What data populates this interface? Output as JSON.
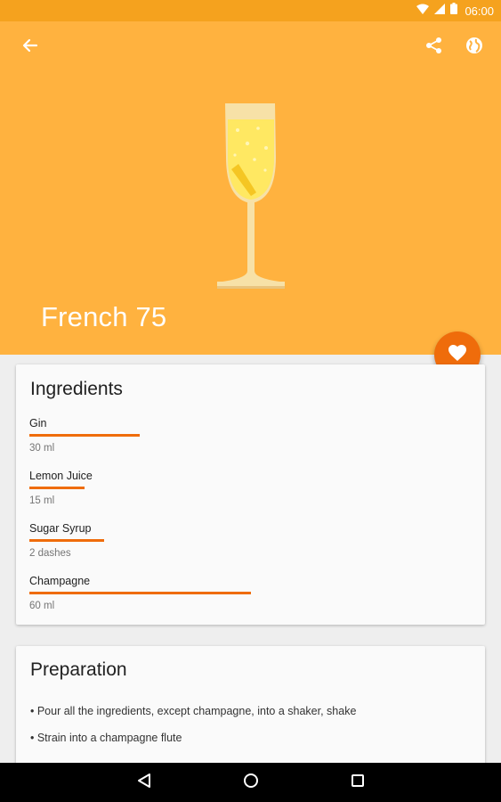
{
  "status_bar": {
    "time": "06:00"
  },
  "header": {
    "title": "French 75",
    "color": "#FFB23F",
    "actions": [
      "back-arrow-icon",
      "share-icon",
      "globe-icon"
    ]
  },
  "fab": {
    "icon": "heart-icon",
    "color": "#EF6C0B"
  },
  "ingredients": {
    "heading": "Ingredients",
    "items": [
      {
        "name": "Gin",
        "amount": "30 ml",
        "proportion": 0.25
      },
      {
        "name": "Lemon Juice",
        "amount": "15 ml",
        "proportion": 0.125
      },
      {
        "name": "Sugar Syrup",
        "amount": "2 dashes",
        "proportion": 0.17
      },
      {
        "name": "Champagne",
        "amount": "60 ml",
        "proportion": 0.5
      }
    ]
  },
  "preparation": {
    "heading": "Preparation",
    "steps": [
      "• Pour all the ingredients, except champagne, into a shaker, shake",
      "• Strain into a champagne flute"
    ]
  },
  "accent_color": "#EF6C0B"
}
